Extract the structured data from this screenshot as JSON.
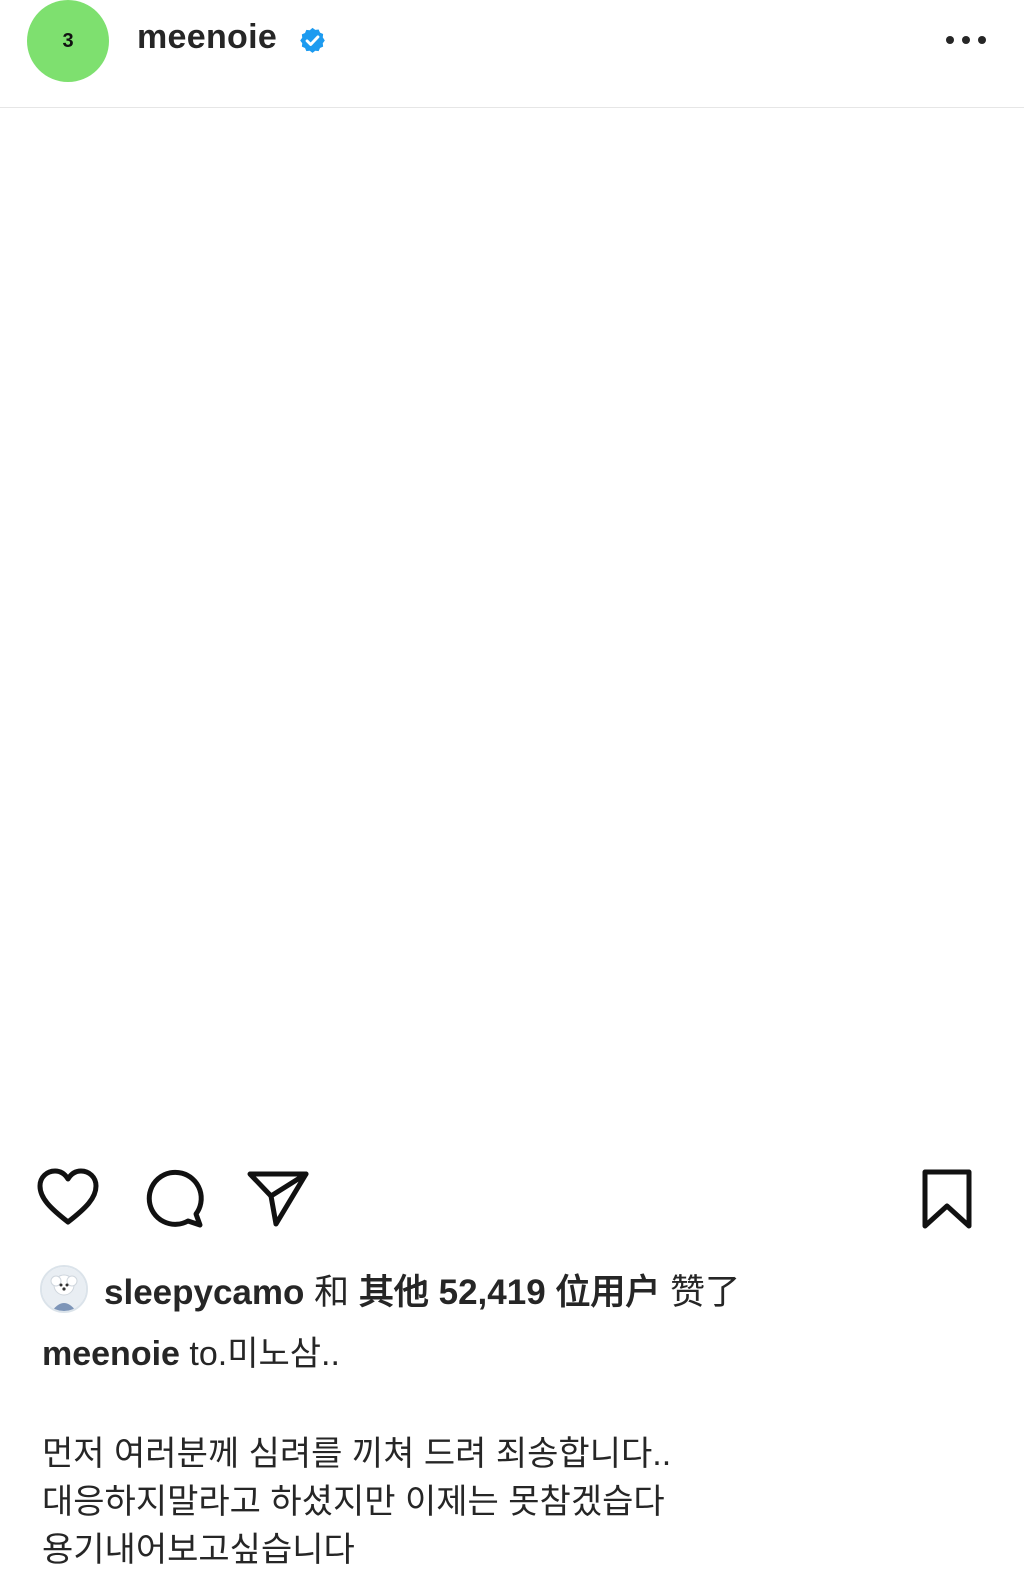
{
  "header": {
    "avatar_text": "3",
    "username": "meenoie",
    "verified_icon": "verified-badge-icon",
    "more_icon": "more-options-icon"
  },
  "actions": {
    "like_icon": "heart-icon",
    "comment_icon": "comment-icon",
    "share_icon": "send-icon",
    "save_icon": "bookmark-icon"
  },
  "likes": {
    "liker": "sleepycamo",
    "connector": "和",
    "others": "其他 52,419 位用户",
    "suffix": "赞了"
  },
  "caption": {
    "username": "meenoie",
    "title": "to.미노삼..",
    "lines": [
      "먼저 여러분께 심려를 끼쳐 드려 죄송합니다..",
      "대응하지말라고 하셨지만 이제는 못참겠습다",
      "용기내어보고싶습니다"
    ]
  },
  "colors": {
    "avatar_bg": "#7ee06f",
    "verified_blue": "#1d9bf0",
    "text": "#262626"
  }
}
